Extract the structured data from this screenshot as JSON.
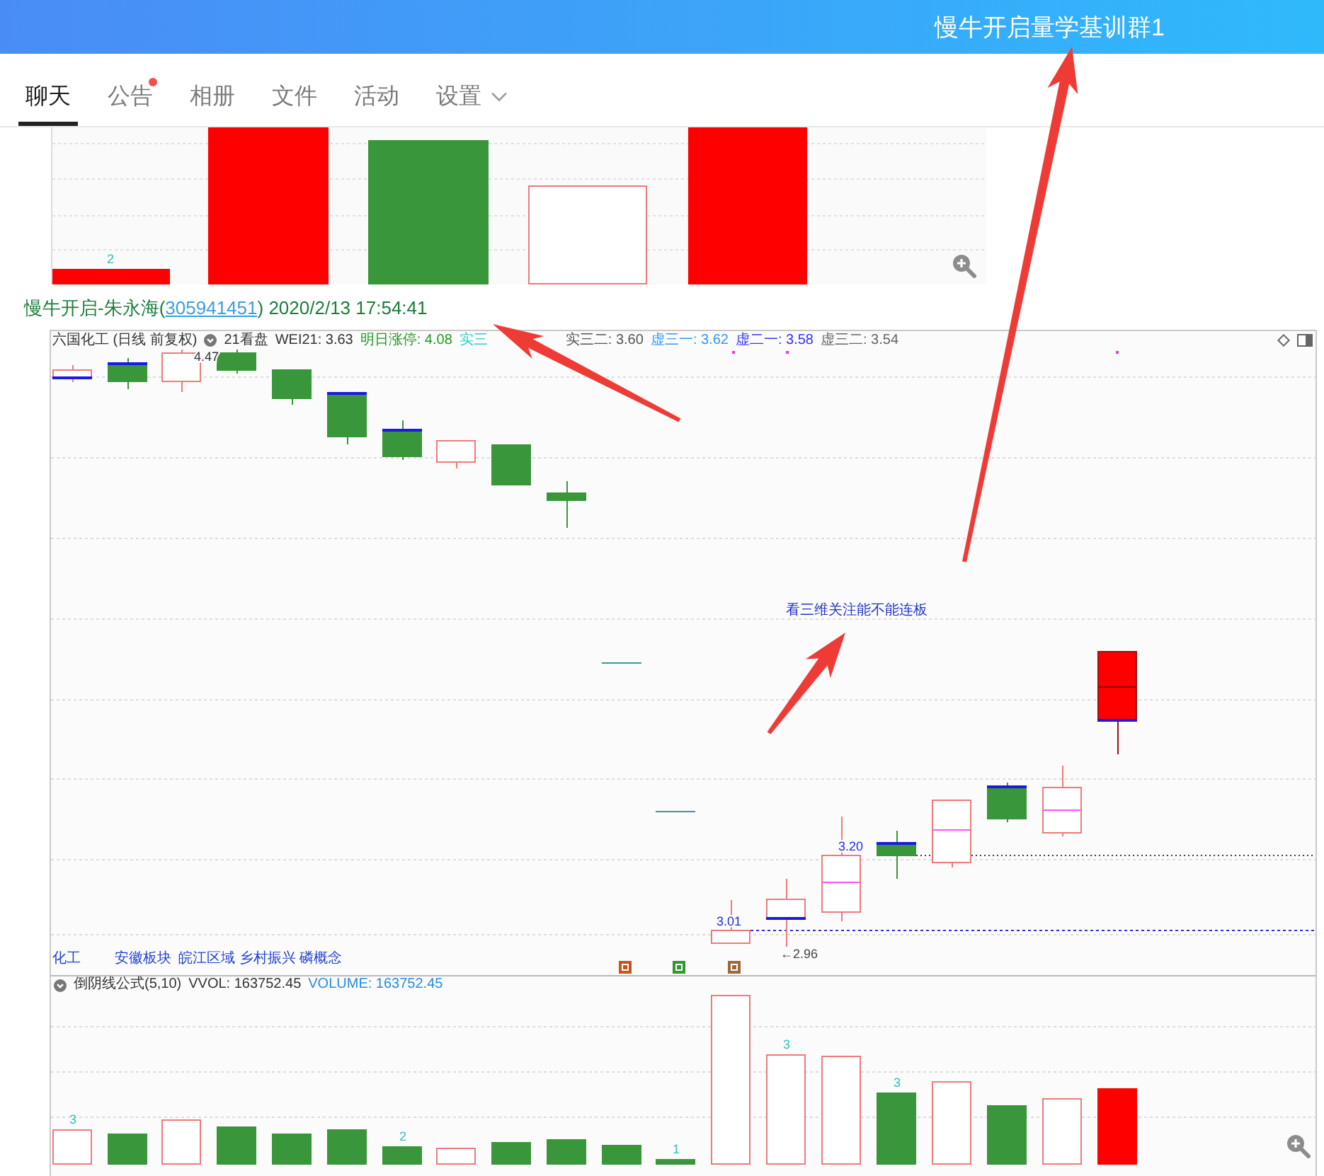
{
  "window": {
    "title": "慢牛开启量学基训群1"
  },
  "tabs": [
    {
      "label": "聊天",
      "selected": true,
      "badge": false,
      "dropdown": false
    },
    {
      "label": "公告",
      "selected": false,
      "badge": true,
      "dropdown": false
    },
    {
      "label": "相册",
      "selected": false,
      "badge": false,
      "dropdown": false
    },
    {
      "label": "文件",
      "selected": false,
      "badge": false,
      "dropdown": false
    },
    {
      "label": "活动",
      "selected": false,
      "badge": false,
      "dropdown": false
    },
    {
      "label": "设置",
      "selected": false,
      "badge": false,
      "dropdown": true
    }
  ],
  "messages": [
    {
      "image": {
        "kind": "volume_crop",
        "bar_labels": [
          "2"
        ]
      }
    },
    {
      "sender": "慢牛开启-朱永海",
      "id_open": "(",
      "id": "305941451",
      "id_close": ")",
      "time": "2020/2/13 17:54:41",
      "image": {
        "kind": "stock_chart",
        "stock": "六国化工 (日线 前复权)",
        "indicator": "21看盘",
        "readings": [
          {
            "text": "WEI21: 3.63",
            "color": "#333333"
          },
          {
            "text": "明日涨停: 4.08",
            "color": "#1e9a1e"
          },
          {
            "text": "实三",
            "color": "#33cccc"
          },
          {
            "text": "实三二: 3.60",
            "color": "#555555"
          },
          {
            "text": "虚三一: 3.62",
            "color": "#3399ff"
          },
          {
            "text": "虚二一: 3.58",
            "color": "#3333ff"
          },
          {
            "text": "虚三二: 3.54",
            "color": "#666666"
          }
        ],
        "price_labels": [
          "4.47",
          "3.01",
          "←2.96",
          "3.20"
        ],
        "note": "看三维关注能不能连板",
        "sectors": [
          "化工",
          "安徽板块",
          "皖江区域 乡村振兴 磷概念"
        ],
        "volume_formula": "倒阴线公式(5,10)",
        "volume_readings": [
          {
            "text": "VVOL: 163752.45",
            "color": "#333333"
          },
          {
            "text": "VOLUME: 163752.45",
            "color": "#2a8ce0"
          }
        ],
        "bar_labels": [
          "3",
          "2",
          "1",
          "3",
          "3"
        ]
      }
    }
  ]
}
